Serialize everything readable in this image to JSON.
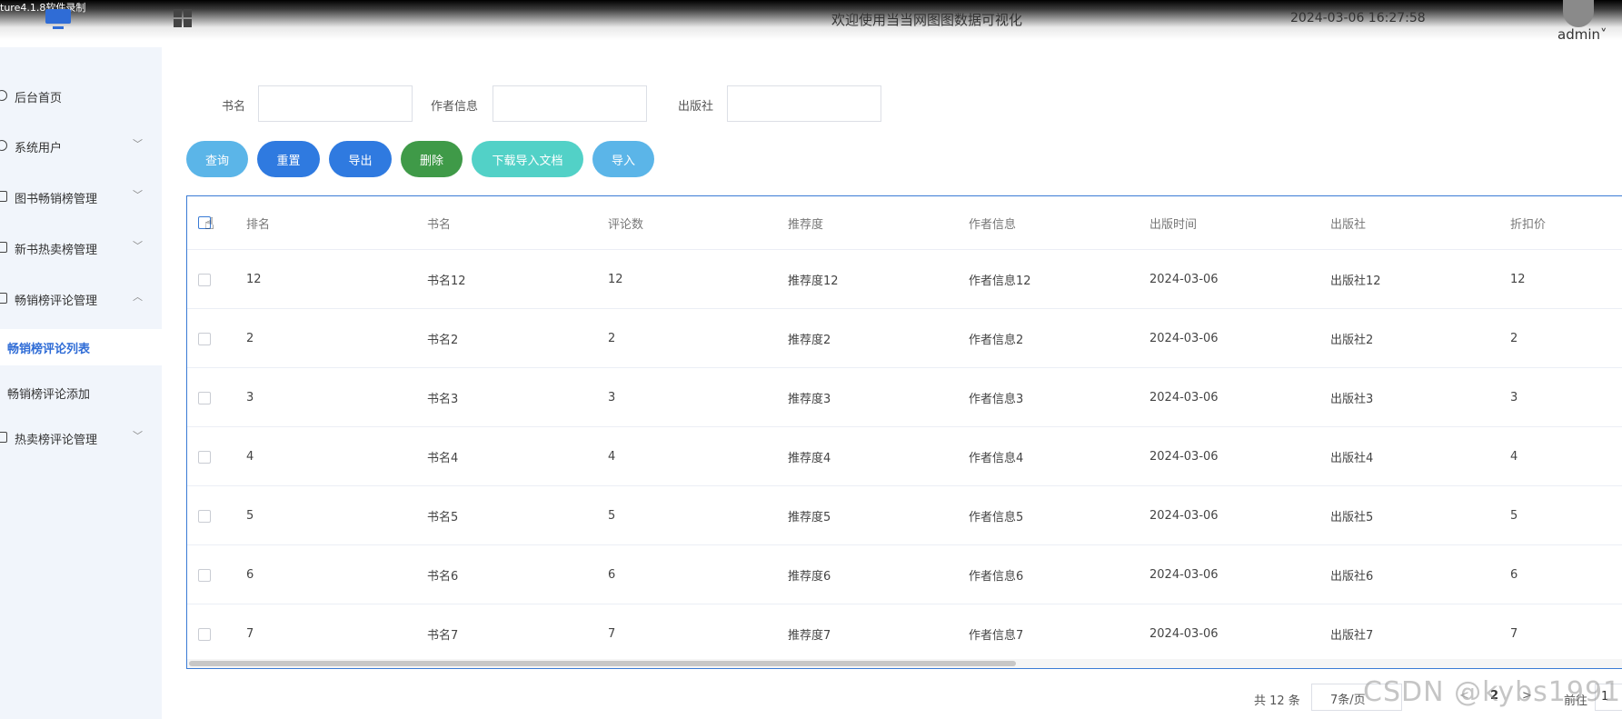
{
  "recorder": {
    "label": "ture4.1.8软件录制"
  },
  "header": {
    "title": "欢迎使用当当网图图数据可视化",
    "datetime": "2024-03-06 16:27:58",
    "user": "admin",
    "user_caret": "˅"
  },
  "sidebar": {
    "items": [
      {
        "label": "后台首页",
        "icon": "home-icon"
      },
      {
        "label": "系统用户",
        "icon": "user-icon",
        "chevron": "﹀"
      },
      {
        "label": "图书畅销榜管理",
        "icon": "doc-icon",
        "chevron": "﹀"
      },
      {
        "label": "新书热卖榜管理",
        "icon": "doc-icon",
        "chevron": "﹀"
      },
      {
        "label": "畅销榜评论管理",
        "icon": "doc-icon",
        "chevron": "︿"
      },
      {
        "label": "热卖榜评论管理",
        "icon": "doc-icon",
        "chevron": "﹀"
      }
    ],
    "subitems": [
      {
        "label": "畅销榜评论列表",
        "active": true
      },
      {
        "label": "畅销榜评论添加",
        "active": false
      }
    ]
  },
  "filters": {
    "book_name_label": "书名",
    "author_label": "作者信息",
    "publisher_label": "出版社",
    "book_name_value": "",
    "author_value": "",
    "publisher_value": ""
  },
  "actions": {
    "query": "查询",
    "reset": "重置",
    "export": "导出",
    "delete": "删除",
    "download_template": "下载导入文档",
    "import": "导入"
  },
  "colors": {
    "query": "#5bb5e8",
    "reset": "#2f7ae0",
    "export": "#2f7ae0",
    "delete": "#3f9a48",
    "download_template": "#52d1c7",
    "import": "#5bb5e8",
    "accent": "#2f6cd6"
  },
  "table": {
    "columns": [
      "排名",
      "书名",
      "评论数",
      "推荐度",
      "作者信息",
      "出版时间",
      "出版社",
      "折扣价"
    ],
    "rows": [
      [
        "12",
        "书名12",
        "12",
        "推荐度12",
        "作者信息12",
        "2024-03-06",
        "出版社12",
        "12"
      ],
      [
        "2",
        "书名2",
        "2",
        "推荐度2",
        "作者信息2",
        "2024-03-06",
        "出版社2",
        "2"
      ],
      [
        "3",
        "书名3",
        "3",
        "推荐度3",
        "作者信息3",
        "2024-03-06",
        "出版社3",
        "3"
      ],
      [
        "4",
        "书名4",
        "4",
        "推荐度4",
        "作者信息4",
        "2024-03-06",
        "出版社4",
        "4"
      ],
      [
        "5",
        "书名5",
        "5",
        "推荐度5",
        "作者信息5",
        "2024-03-06",
        "出版社5",
        "5"
      ],
      [
        "6",
        "书名6",
        "6",
        "推荐度6",
        "作者信息6",
        "2024-03-06",
        "出版社6",
        "6"
      ],
      [
        "7",
        "书名7",
        "7",
        "推荐度7",
        "作者信息7",
        "2024-03-06",
        "出版社7",
        "7"
      ]
    ]
  },
  "pagination": {
    "total": "共 12 条",
    "page_size": "7条/页",
    "prev": "<",
    "current_page": "2",
    "next": ">",
    "goto": "前往",
    "jump_value": "1"
  },
  "watermark": "CSDN @kybs1991"
}
